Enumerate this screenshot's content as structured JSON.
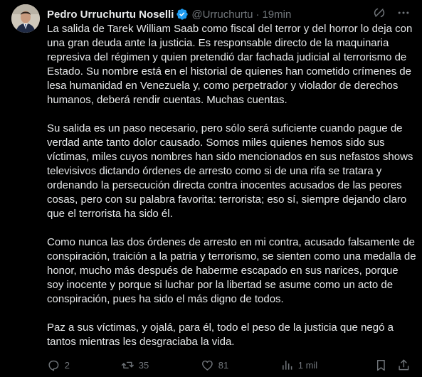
{
  "author": {
    "name": "Pedro Urruchurtu Noselli",
    "handle": "@Urruchurtu",
    "separator": "·",
    "time": "19min",
    "verified_color": "#1d9bf0"
  },
  "tweet": {
    "paragraphs": [
      "La salida de Tarek William Saab como fiscal del terror y del horror lo deja con una gran deuda ante la justicia. Es responsable directo de la maquinaria represiva del régimen y quien pretendió dar fachada judicial al terrorismo de Estado. Su nombre está en el historial de quienes han cometido crímenes de lesa humanidad en Venezuela y, como perpetrador y violador de derechos humanos, deberá rendir cuentas. Muchas cuentas.",
      "Su salida es un paso necesario, pero sólo será suficiente cuando pague de verdad ante tanto dolor causado. Somos miles quienes hemos sido sus víctimas, miles cuyos nombres han sido mencionados en sus nefastos shows televisivos dictando órdenes de arresto como si de una rifa se tratara y ordenando la persecución directa contra inocentes acusados de las peores cosas, pero con su palabra favorita: terrorista; eso sí, siempre dejando claro que el terrorista ha sido él.",
      "Como nunca las dos órdenes de arresto en mi contra, acusado falsamente de conspiración, traición a la patria y terrorismo, se sienten como una medalla de honor, mucho más después de haberme escapado en sus narices, porque soy inocente y porque si luchar por la libertad se asume como un acto de conspiración, pues ha sido el más digno de todos.",
      "Paz a sus víctimas, y ojalá, para él, todo el peso de la justicia que negó a tantos mientras les desgraciaba la vida."
    ]
  },
  "actions": {
    "replies": "2",
    "reposts": "35",
    "likes": "81",
    "views": "1 mil"
  },
  "icons": {
    "header": [
      "grok-icon",
      "more-icon"
    ],
    "actions": [
      "reply-icon",
      "repost-icon",
      "like-icon",
      "views-icon",
      "bookmark-icon",
      "share-icon"
    ]
  }
}
